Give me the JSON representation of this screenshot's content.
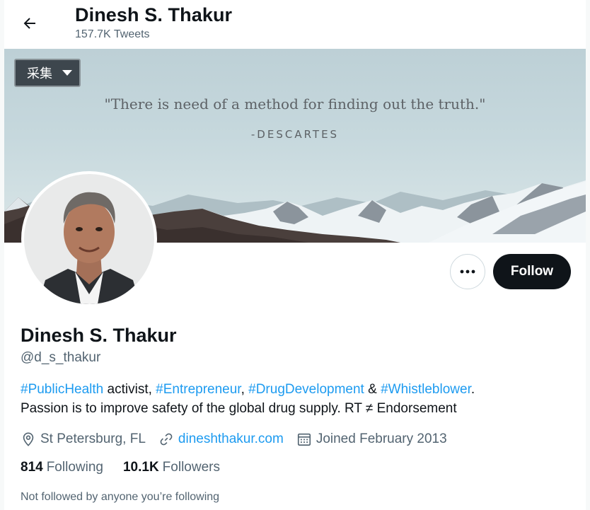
{
  "header": {
    "title": "Dinesh S. Thakur",
    "tweet_count": "157.7K Tweets"
  },
  "banner": {
    "collect_button": "采集",
    "quote": "\"There is need of a method for finding out the truth.\"",
    "author": "-DESCARTES"
  },
  "actions": {
    "more_icon": "more-horizontal-icon",
    "follow_label": "Follow"
  },
  "profile": {
    "name": "Dinesh S. Thakur",
    "handle": "@d_s_thakur",
    "bio": {
      "tag1": "#PublicHealth",
      "text1": " activist, ",
      "tag2": "#Entrepreneur",
      "text2": ", ",
      "tag3": "#DrugDevelopment",
      "text3": " & ",
      "tag4": "#Whistleblower",
      "text4": ".",
      "line2": "Passion is to improve safety of the global drug supply. RT ≠ Endorsement"
    },
    "location": "St Petersburg, FL",
    "website": "dineshthakur.com",
    "joined": "Joined February 2013",
    "following_count": "814",
    "following_label": "Following",
    "followers_count": "10.1K",
    "followers_label": "Followers",
    "not_followed": "Not followed by anyone you’re following"
  },
  "colors": {
    "link": "#1d9bf0",
    "text": "#0f1419",
    "secondary": "#536471",
    "follow_bg": "#0f1419"
  }
}
